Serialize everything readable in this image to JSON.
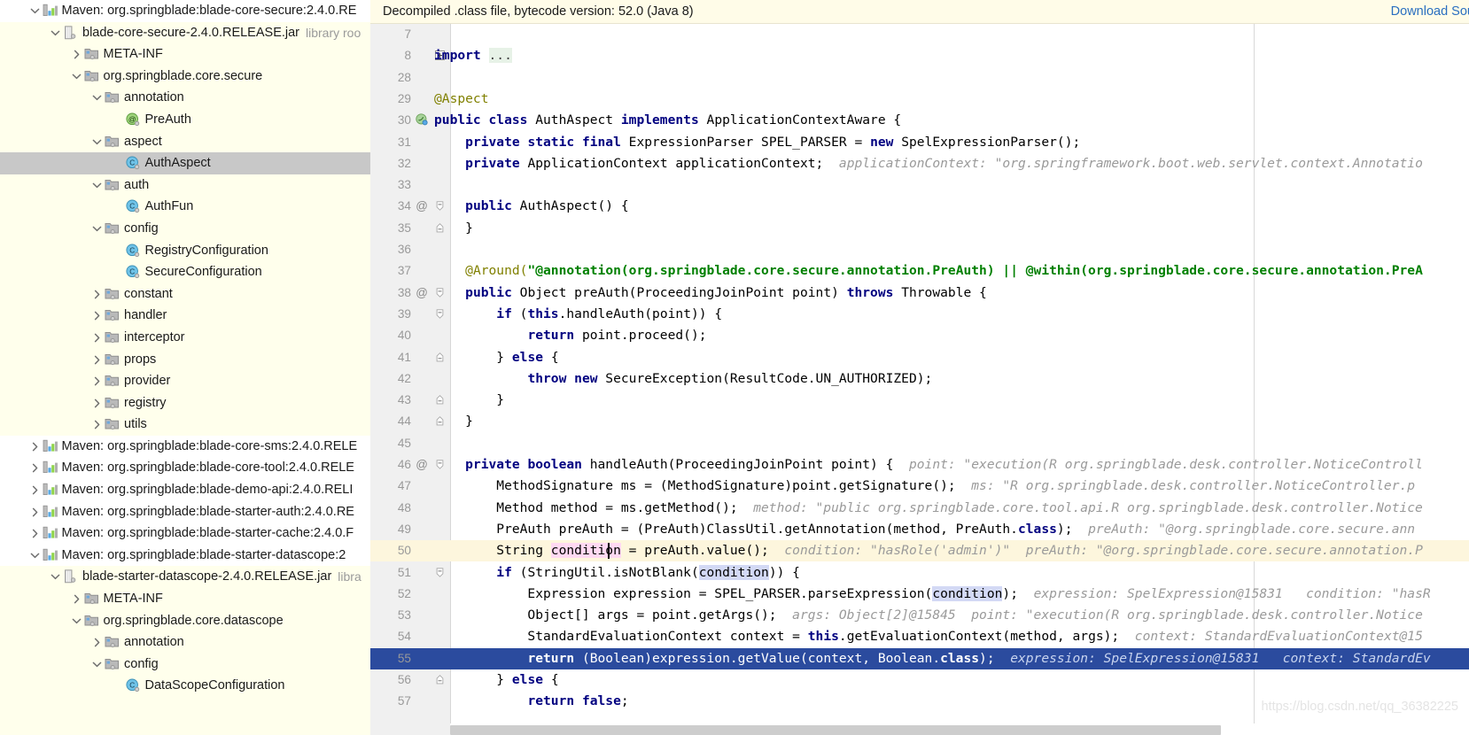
{
  "banner": {
    "message": "Decompiled .class file, bytecode version: 52.0 (Java 8)",
    "link_label": "Download Sou",
    "bg_color": "#fffce8",
    "link_color": "#2a6fc0"
  },
  "watermark": "https://blog.csdn.net/qq_36382225",
  "tree": {
    "items": [
      {
        "indent": 1,
        "twisty": "down",
        "icon": "maven-module-icon",
        "label": "Maven: org.springblade:blade-core-secure:2.4.0.RE",
        "sub": "",
        "selected": false,
        "row_style": "module"
      },
      {
        "indent": 2,
        "twisty": "down",
        "icon": "jar-icon",
        "label": "blade-core-secure-2.4.0.RELEASE.jar",
        "sub": "library roo",
        "selected": false,
        "row_style": "normal"
      },
      {
        "indent": 3,
        "twisty": "right",
        "icon": "folder-icon",
        "label": "META-INF",
        "sub": "",
        "selected": false,
        "row_style": "normal"
      },
      {
        "indent": 3,
        "twisty": "down",
        "icon": "folder-icon",
        "label": "org.springblade.core.secure",
        "sub": "",
        "selected": false,
        "row_style": "normal"
      },
      {
        "indent": 4,
        "twisty": "down",
        "icon": "folder-icon",
        "label": "annotation",
        "sub": "",
        "selected": false,
        "row_style": "normal"
      },
      {
        "indent": 5,
        "twisty": "none",
        "icon": "annotation-icon",
        "label": "PreAuth",
        "sub": "",
        "selected": false,
        "row_style": "normal"
      },
      {
        "indent": 4,
        "twisty": "down",
        "icon": "folder-icon",
        "label": "aspect",
        "sub": "",
        "selected": false,
        "row_style": "normal"
      },
      {
        "indent": 5,
        "twisty": "none",
        "icon": "class-icon",
        "label": "AuthAspect",
        "sub": "",
        "selected": true,
        "row_style": "normal"
      },
      {
        "indent": 4,
        "twisty": "down",
        "icon": "folder-icon",
        "label": "auth",
        "sub": "",
        "selected": false,
        "row_style": "normal"
      },
      {
        "indent": 5,
        "twisty": "none",
        "icon": "class-icon",
        "label": "AuthFun",
        "sub": "",
        "selected": false,
        "row_style": "normal"
      },
      {
        "indent": 4,
        "twisty": "down",
        "icon": "folder-icon",
        "label": "config",
        "sub": "",
        "selected": false,
        "row_style": "normal"
      },
      {
        "indent": 5,
        "twisty": "none",
        "icon": "class-icon",
        "label": "RegistryConfiguration",
        "sub": "",
        "selected": false,
        "row_style": "normal"
      },
      {
        "indent": 5,
        "twisty": "none",
        "icon": "class-icon",
        "label": "SecureConfiguration",
        "sub": "",
        "selected": false,
        "row_style": "normal"
      },
      {
        "indent": 4,
        "twisty": "right",
        "icon": "folder-icon",
        "label": "constant",
        "sub": "",
        "selected": false,
        "row_style": "normal"
      },
      {
        "indent": 4,
        "twisty": "right",
        "icon": "folder-icon",
        "label": "handler",
        "sub": "",
        "selected": false,
        "row_style": "normal"
      },
      {
        "indent": 4,
        "twisty": "right",
        "icon": "folder-icon",
        "label": "interceptor",
        "sub": "",
        "selected": false,
        "row_style": "normal"
      },
      {
        "indent": 4,
        "twisty": "right",
        "icon": "folder-icon",
        "label": "props",
        "sub": "",
        "selected": false,
        "row_style": "normal"
      },
      {
        "indent": 4,
        "twisty": "right",
        "icon": "folder-icon",
        "label": "provider",
        "sub": "",
        "selected": false,
        "row_style": "normal"
      },
      {
        "indent": 4,
        "twisty": "right",
        "icon": "folder-icon",
        "label": "registry",
        "sub": "",
        "selected": false,
        "row_style": "normal"
      },
      {
        "indent": 4,
        "twisty": "right",
        "icon": "folder-icon",
        "label": "utils",
        "sub": "",
        "selected": false,
        "row_style": "normal"
      },
      {
        "indent": 1,
        "twisty": "right",
        "icon": "maven-module-icon",
        "label": "Maven: org.springblade:blade-core-sms:2.4.0.RELE",
        "sub": "",
        "selected": false,
        "row_style": "module"
      },
      {
        "indent": 1,
        "twisty": "right",
        "icon": "maven-module-icon",
        "label": "Maven: org.springblade:blade-core-tool:2.4.0.RELE",
        "sub": "",
        "selected": false,
        "row_style": "module"
      },
      {
        "indent": 1,
        "twisty": "right",
        "icon": "maven-module-icon",
        "label": "Maven: org.springblade:blade-demo-api:2.4.0.RELI",
        "sub": "",
        "selected": false,
        "row_style": "module"
      },
      {
        "indent": 1,
        "twisty": "right",
        "icon": "maven-module-icon",
        "label": "Maven: org.springblade:blade-starter-auth:2.4.0.RE",
        "sub": "",
        "selected": false,
        "row_style": "module"
      },
      {
        "indent": 1,
        "twisty": "right",
        "icon": "maven-module-icon",
        "label": "Maven: org.springblade:blade-starter-cache:2.4.0.F",
        "sub": "",
        "selected": false,
        "row_style": "module"
      },
      {
        "indent": 1,
        "twisty": "down",
        "icon": "maven-module-icon",
        "label": "Maven: org.springblade:blade-starter-datascope:2",
        "sub": "",
        "selected": false,
        "row_style": "module"
      },
      {
        "indent": 2,
        "twisty": "down",
        "icon": "jar-icon",
        "label": "blade-starter-datascope-2.4.0.RELEASE.jar",
        "sub": "libra",
        "selected": false,
        "row_style": "normal"
      },
      {
        "indent": 3,
        "twisty": "right",
        "icon": "folder-icon",
        "label": "META-INF",
        "sub": "",
        "selected": false,
        "row_style": "normal"
      },
      {
        "indent": 3,
        "twisty": "down",
        "icon": "folder-icon",
        "label": "org.springblade.core.datascope",
        "sub": "",
        "selected": false,
        "row_style": "normal"
      },
      {
        "indent": 4,
        "twisty": "right",
        "icon": "folder-icon",
        "label": "annotation",
        "sub": "",
        "selected": false,
        "row_style": "normal"
      },
      {
        "indent": 4,
        "twisty": "down",
        "icon": "folder-icon",
        "label": "config",
        "sub": "",
        "selected": false,
        "row_style": "normal"
      },
      {
        "indent": 5,
        "twisty": "none",
        "icon": "class-icon",
        "label": "DataScopeConfiguration",
        "sub": "",
        "selected": false,
        "row_style": "normal"
      }
    ]
  },
  "editor": {
    "file": "AuthAspect",
    "first_visible_line": 7,
    "caret_line": 50,
    "execution_line": 55,
    "lines": [
      {
        "n": "7",
        "gmark": "",
        "fold": "",
        "row": "plain",
        "html": ""
      },
      {
        "n": "8",
        "gmark": "",
        "fold": "plus",
        "row": "plain",
        "html": "<span class=\"kw\">import</span> <span class=\"dots\">...</span>"
      },
      {
        "n": "28",
        "gmark": "",
        "fold": "",
        "row": "plain",
        "html": ""
      },
      {
        "n": "29",
        "gmark": "",
        "fold": "",
        "row": "plain",
        "html": "<span class=\"ann\">@Aspect</span>"
      },
      {
        "n": "30",
        "gmark": "bean",
        "fold": "",
        "row": "plain",
        "html": "<span class=\"kw\">public class</span> AuthAspect <span class=\"kw\">implements</span> ApplicationContextAware {"
      },
      {
        "n": "31",
        "gmark": "",
        "fold": "",
        "row": "plain",
        "html": "    <span class=\"kw\">private static final</span> ExpressionParser SPEL_PARSER = <span class=\"kw\">new</span> SpelExpressionParser();"
      },
      {
        "n": "32",
        "gmark": "",
        "fold": "",
        "row": "plain",
        "html": "    <span class=\"kw\">private</span> ApplicationContext applicationContext;  <span class=\"hint\">applicationContext: \"org.springframework.boot.web.servlet.context.Annotatio</span>"
      },
      {
        "n": "33",
        "gmark": "",
        "fold": "",
        "row": "plain",
        "html": ""
      },
      {
        "n": "34",
        "gmark": "@",
        "fold": "open",
        "row": "plain",
        "html": "    <span class=\"kw\">public</span> AuthAspect() {"
      },
      {
        "n": "35",
        "gmark": "",
        "fold": "close",
        "row": "plain",
        "html": "    }"
      },
      {
        "n": "36",
        "gmark": "",
        "fold": "",
        "row": "plain",
        "html": ""
      },
      {
        "n": "37",
        "gmark": "",
        "fold": "",
        "row": "plain",
        "html": "    <span class=\"ann\">@Around(</span><span class=\"str\">\"@annotation(org.springblade.core.secure.annotation.PreAuth) || @within(org.springblade.core.secure.annotation.PreA</span>"
      },
      {
        "n": "38",
        "gmark": "@",
        "fold": "open",
        "row": "plain",
        "html": "    <span class=\"kw\">public</span> Object preAuth(ProceedingJoinPoint point) <span class=\"kw\">throws</span> Throwable {"
      },
      {
        "n": "39",
        "gmark": "",
        "fold": "open",
        "row": "plain",
        "html": "        <span class=\"kw\">if</span> (<span class=\"kw\">this</span>.handleAuth(point)) {"
      },
      {
        "n": "40",
        "gmark": "",
        "fold": "",
        "row": "plain",
        "html": "            <span class=\"kw\">return</span> point.proceed();"
      },
      {
        "n": "41",
        "gmark": "",
        "fold": "close",
        "row": "plain",
        "html": "        } <span class=\"kw\">else</span> {"
      },
      {
        "n": "42",
        "gmark": "",
        "fold": "",
        "row": "plain",
        "html": "            <span class=\"kw\">throw new</span> SecureException(ResultCode.UN_AUTHORIZED);"
      },
      {
        "n": "43",
        "gmark": "",
        "fold": "close",
        "row": "plain",
        "html": "        }"
      },
      {
        "n": "44",
        "gmark": "",
        "fold": "close",
        "row": "plain",
        "html": "    }"
      },
      {
        "n": "45",
        "gmark": "",
        "fold": "",
        "row": "plain",
        "html": ""
      },
      {
        "n": "46",
        "gmark": "@",
        "fold": "open",
        "row": "plain",
        "html": "    <span class=\"kw\">private boolean</span> handleAuth(ProceedingJoinPoint point) {  <span class=\"hint\">point: \"execution(R org.springblade.desk.controller.NoticeControll</span>"
      },
      {
        "n": "47",
        "gmark": "",
        "fold": "",
        "row": "plain",
        "html": "        MethodSignature ms = (MethodSignature)point.getSignature();  <span class=\"hint\">ms: \"R org.springblade.desk.controller.NoticeController.p</span>"
      },
      {
        "n": "48",
        "gmark": "",
        "fold": "",
        "row": "plain",
        "html": "        Method method = ms.getMethod();  <span class=\"hint\">method: \"public org.springblade.core.tool.api.R org.springblade.desk.controller.Notice</span>"
      },
      {
        "n": "49",
        "gmark": "",
        "fold": "",
        "row": "plain",
        "html": "        PreAuth preAuth = (PreAuth)ClassUtil.getAnnotation(method, PreAuth.<span class=\"kw\">class</span>);  <span class=\"hint\">preAuth: \"@org.springblade.core.secure.ann</span>"
      },
      {
        "n": "50",
        "gmark": "",
        "fold": "",
        "row": "caret",
        "html": "        String <span class=\"sel-pink\">condition</span> = preAuth.value();  <span class=\"hint\">condition: \"hasRole('admin')\"  preAuth: \"@org.springblade.core.secure.annotation.P</span>"
      },
      {
        "n": "51",
        "gmark": "",
        "fold": "open",
        "row": "plain",
        "html": "        <span class=\"kw\">if</span> (StringUtil.isNotBlank(<span class=\"sel-blue\">condition</span>)) {"
      },
      {
        "n": "52",
        "gmark": "",
        "fold": "",
        "row": "plain",
        "html": "            Expression expression = SPEL_PARSER.parseExpression(<span class=\"sel-blue\">condition</span>);  <span class=\"hint\">expression: SpelExpression@15831   condition: \"hasR</span>"
      },
      {
        "n": "53",
        "gmark": "",
        "fold": "",
        "row": "plain",
        "html": "            Object[] args = point.getArgs();  <span class=\"hint\">args: Object[2]@15845  point: \"execution(R org.springblade.desk.controller.Notice</span>"
      },
      {
        "n": "54",
        "gmark": "",
        "fold": "",
        "row": "plain",
        "html": "            StandardEvaluationContext context = <span class=\"kw\">this</span>.getEvaluationContext(method, args);  <span class=\"hint\">context: StandardEvaluationContext@15</span>"
      },
      {
        "n": "55",
        "gmark": "",
        "fold": "",
        "row": "exec",
        "html": "            <span class=\"kw\">return</span> (Boolean)expression.getValue(context, Boolean.<span class=\"kw\">class</span>);  <span class=\"hint\">expression: SpelExpression@15831   context: StandardEv</span>"
      },
      {
        "n": "56",
        "gmark": "",
        "fold": "close",
        "row": "plain",
        "html": "        } <span class=\"kw\">else</span> {"
      },
      {
        "n": "57",
        "gmark": "",
        "fold": "",
        "row": "plain",
        "html": "            <span class=\"kw\">return false</span>;"
      }
    ]
  },
  "scrollbar": {
    "thumb_left": 0,
    "thumb_width": 870
  }
}
